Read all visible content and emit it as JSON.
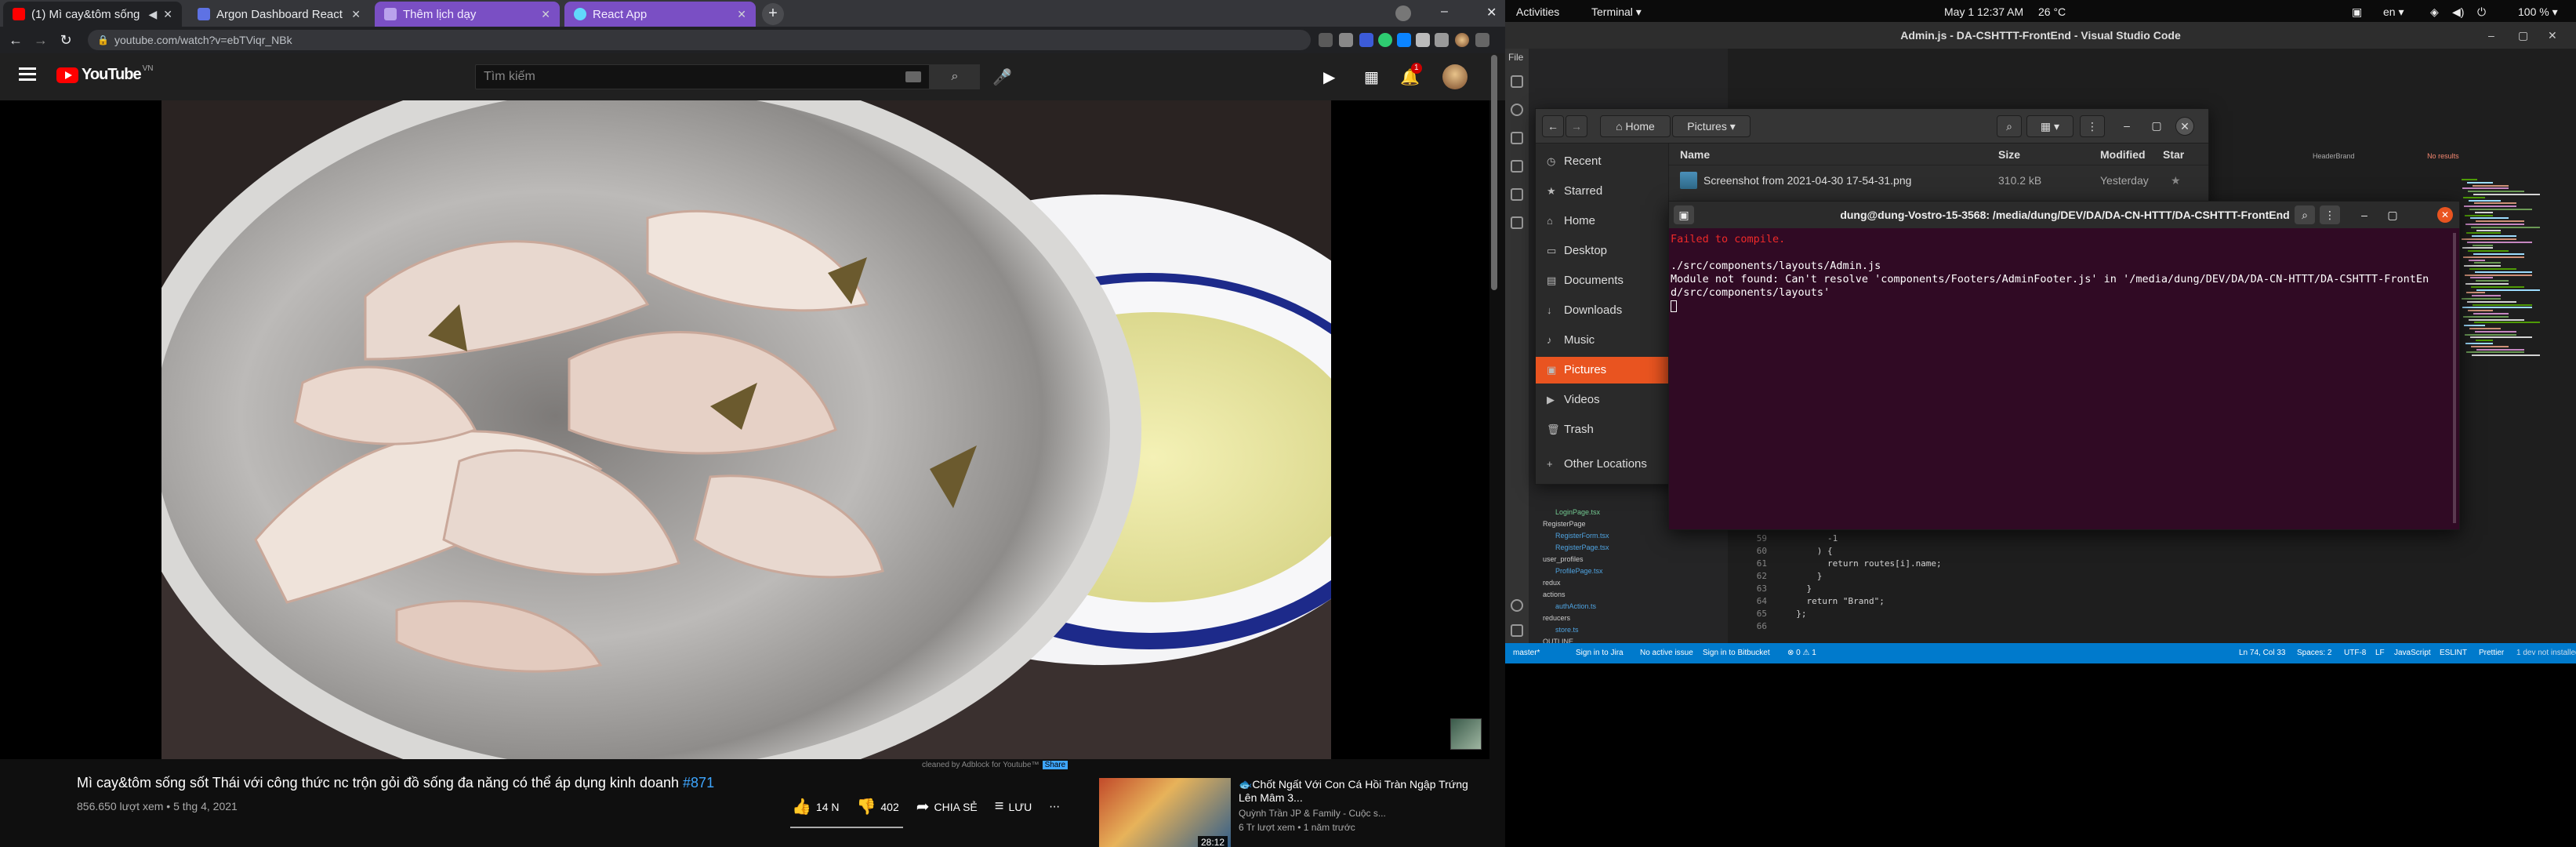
{
  "browser": {
    "tabs": [
      {
        "title": "(1) Mì cay&tôm sống"
      },
      {
        "title": "Argon Dashboard React"
      },
      {
        "title": "Thêm lịch dạy"
      },
      {
        "title": "React App"
      }
    ],
    "url": "youtube.com/watch?v=ebTViqr_NBk",
    "window_controls": {
      "minimize": "–",
      "close": "✕"
    }
  },
  "youtube": {
    "logo_text": "YouTube",
    "logo_country": "VN",
    "search_placeholder": "Tìm kiếm",
    "notification_count": "1",
    "cleaned_text": "cleaned by Adblock for Youtube™",
    "share_text": "Share",
    "video": {
      "title": "Mì cay&tôm sống sốt Thái với công thức nc trộn gỏi đồ sống đa năng có thể áp dụng kinh doanh",
      "hashtag": "#871",
      "views_date": "856.650 lượt xem • 5 thg 4, 2021",
      "likes": "14 N",
      "dislikes": "402",
      "share": "CHIA SẺ",
      "save": "LƯU",
      "more": "⋯"
    },
    "recommendation": {
      "title": "🐟Chốt Ngất Với Con Cá Hồi Tràn Ngập Trứng Lên Mâm 3...",
      "channel": "Quỳnh Trần JP & Family - Cuộc s...",
      "views": "6 Tr lượt xem • 1 năm trước",
      "duration": "28:12"
    }
  },
  "ubuntu": {
    "activities": "Activities",
    "app_menu": "Terminal ▾",
    "clock": "May 1  12:37 AM",
    "weather": "26 °C",
    "lang": "en ▾",
    "battery": "100 % ▾"
  },
  "vscode": {
    "title": "Admin.js - DA-CSHTTT-FrontEnd - Visual Studio Code",
    "file_label": "File",
    "tree": [
      {
        "label": "LoginPage.tsx",
        "kind": "green"
      },
      {
        "label": "RegisterPage",
        "kind": "plain"
      },
      {
        "label": "RegisterForm.tsx",
        "kind": "blue"
      },
      {
        "label": "RegisterPage.tsx",
        "kind": "blue"
      },
      {
        "label": "user_profiles",
        "kind": "plain"
      },
      {
        "label": "ProfilePage.tsx",
        "kind": "blue"
      },
      {
        "label": "redux",
        "kind": "plain"
      },
      {
        "label": "actions",
        "kind": "plain"
      },
      {
        "label": "authAction.ts",
        "kind": "blue"
      },
      {
        "label": "reducers",
        "kind": "plain"
      },
      {
        "label": "store.ts",
        "kind": "blue"
      },
      {
        "label": "OUTLINE",
        "kind": "plain"
      },
      {
        "label": "TIMELINE",
        "kind": "plain"
      }
    ],
    "code_lines": [
      {
        "n": "59",
        "t": "        -1"
      },
      {
        "n": "60",
        "t": "      ) {"
      },
      {
        "n": "61",
        "t": "        return routes[i].name;"
      },
      {
        "n": "62",
        "t": "      }"
      },
      {
        "n": "63",
        "t": "    }"
      },
      {
        "n": "64",
        "t": "    return \"Brand\";"
      },
      {
        "n": "65",
        "t": "  };"
      },
      {
        "n": "66",
        "t": ""
      }
    ],
    "search_panel": "HeaderBrand",
    "no_results": "No results",
    "status": {
      "branch": "master*",
      "jira": "Sign in to Jira",
      "issue": "No active issue",
      "bitbucket": "Sign in to Bitbucket",
      "problems": "⊗ 0 ⚠ 1",
      "position": "Ln 74, Col 33",
      "spaces": "Spaces: 2",
      "encoding": "UTF-8",
      "eol": "LF",
      "lang": "JavaScript",
      "eslint": "ESLINT",
      "prettier": "Prettier",
      "dev": "1 dev not installed"
    }
  },
  "nautilus": {
    "breadcrumbs": [
      "Home",
      "Pictures"
    ],
    "places": [
      {
        "label": "Recent",
        "icon": "◷"
      },
      {
        "label": "Starred",
        "icon": "★"
      },
      {
        "label": "Home",
        "icon": "⌂"
      },
      {
        "label": "Desktop",
        "icon": "▭"
      },
      {
        "label": "Documents",
        "icon": "▤"
      },
      {
        "label": "Downloads",
        "icon": "↓"
      },
      {
        "label": "Music",
        "icon": "♪"
      },
      {
        "label": "Pictures",
        "icon": "▣"
      },
      {
        "label": "Videos",
        "icon": "▶"
      },
      {
        "label": "Trash",
        "icon": "🗑"
      },
      {
        "label": "Other Locations",
        "icon": "+"
      }
    ],
    "columns": {
      "name": "Name",
      "size": "Size",
      "modified": "Modified",
      "star": "Star"
    },
    "file": {
      "name": "Screenshot from 2021-04-30 17-54-31.png",
      "size": "310.2 kB",
      "modified": "Yesterday"
    }
  },
  "terminal": {
    "title": "dung@dung-Vostro-15-3568: /media/dung/DEV/DA/DA-CN-HTTT/DA-CSHTTT-FrontEnd",
    "lines": {
      "failed": "Failed to compile.",
      "file": "./src/components/layouts/Admin.js",
      "error": "Module not found: Can't resolve 'components/Footers/AdminFooter.js' in '/media/dung/DEV/DA/DA-CN-HTTT/DA-CSHTTT-FrontEnd/src/components/layouts'"
    }
  }
}
